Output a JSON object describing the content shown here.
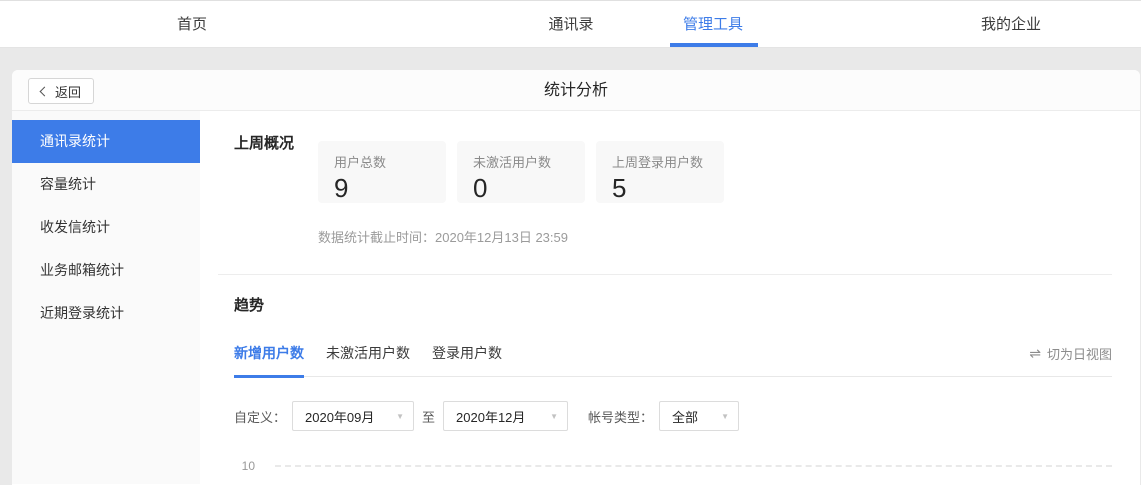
{
  "colors": {
    "accent": "#3d7ce8"
  },
  "nav": {
    "items": [
      {
        "label": "首页"
      },
      {
        "label": "通讯录"
      },
      {
        "label": "管理工具"
      },
      {
        "label": "我的企业"
      }
    ],
    "active_index": 2
  },
  "header": {
    "back_label": "返回",
    "title": "统计分析"
  },
  "sidebar": {
    "items": [
      {
        "label": "通讯录统计"
      },
      {
        "label": "容量统计"
      },
      {
        "label": "收发信统计"
      },
      {
        "label": "业务邮箱统计"
      },
      {
        "label": "近期登录统计"
      }
    ],
    "active_index": 0
  },
  "overview": {
    "section_title": "上周概况",
    "cards": [
      {
        "label": "用户总数",
        "value": "9"
      },
      {
        "label": "未激活用户数",
        "value": "0"
      },
      {
        "label": "上周登录用户数",
        "value": "5"
      }
    ],
    "data_cutoff_note": "数据统计截止时间：2020年12月13日 23:59"
  },
  "trend": {
    "section_title": "趋势",
    "tabs": [
      {
        "label": "新增用户数"
      },
      {
        "label": "未激活用户数"
      },
      {
        "label": "登录用户数"
      }
    ],
    "active_tab_index": 0,
    "view_toggle": {
      "icon_glyph": "⇌",
      "label": "切为日视图"
    },
    "filters": {
      "custom_label": "自定义：",
      "start_month": "2020年09月",
      "to_label": "至",
      "end_month": "2020年12月",
      "account_type_label": "帐号类型：",
      "account_type_value": "全部",
      "caret_glyph": "▼"
    },
    "chart": {
      "visible_y_tick": "10"
    }
  }
}
